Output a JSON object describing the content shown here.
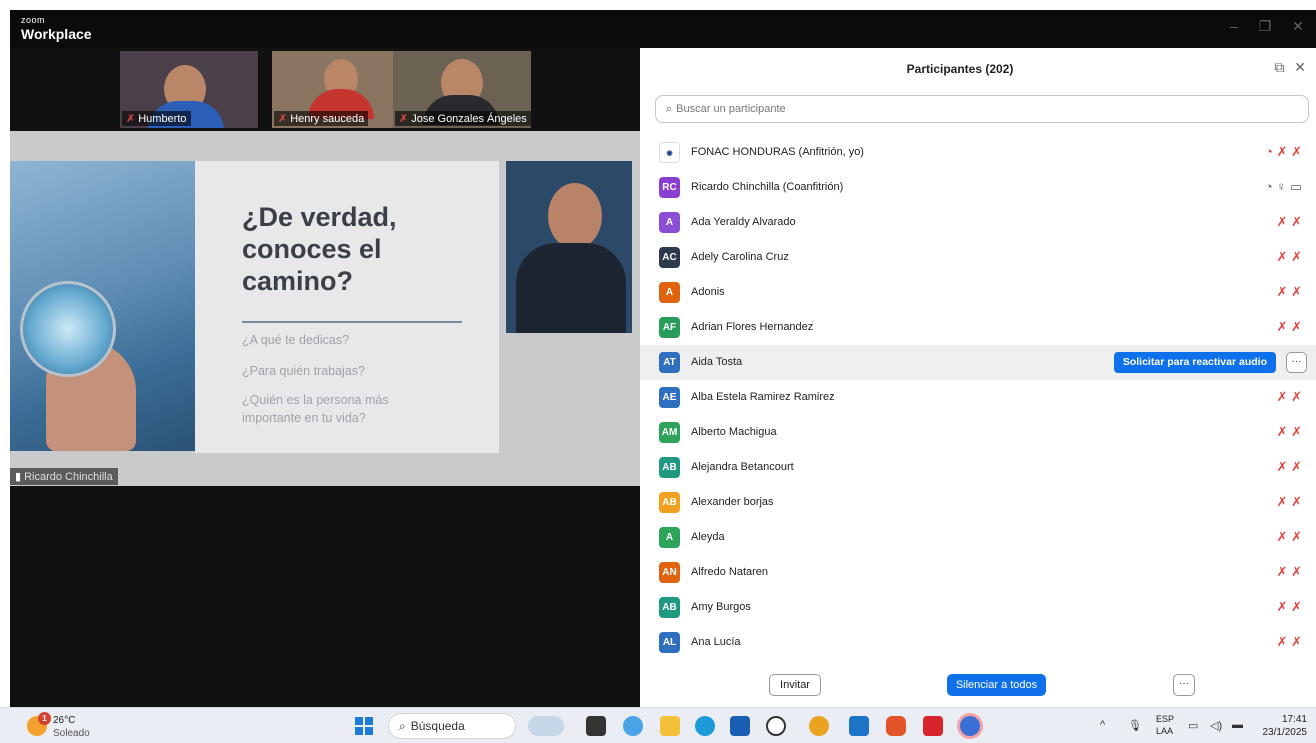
{
  "window": {
    "brand_small": "zoom",
    "brand_big": "Workplace"
  },
  "thumbnails": [
    {
      "name": "Humberto"
    },
    {
      "name": "Henry sauceda"
    },
    {
      "name": "Jose Gonzales Ángeles"
    }
  ],
  "share": {
    "title_lines": [
      "¿De verdad,",
      "conoces el",
      "camino?"
    ],
    "questions": [
      "¿A qué te dedicas?",
      "¿Para quién trabajas?",
      "¿Quién es la persona más",
      "importante en tu vida?"
    ],
    "presenter_label": "Ricardo Chinchilla"
  },
  "panel": {
    "title": "Participantes (202)",
    "search_placeholder": "Buscar un participante",
    "request_unmute": "Solicitar para reactivar audio",
    "more": "···",
    "participants": [
      {
        "initials": "",
        "name": "FONAC HONDURAS (Anfitrión, yo)",
        "color": "#ffffff"
      },
      {
        "initials": "RC",
        "name": "Ricardo Chinchilla (Coanfitrión)",
        "color": "#8a3fd1"
      },
      {
        "initials": "A",
        "name": "Ada Yeraldy Alvarado",
        "color": "#8a4fd6"
      },
      {
        "initials": "AC",
        "name": "Adely Carolina Cruz",
        "color": "#2d3a4d"
      },
      {
        "initials": "A",
        "name": "Adonis",
        "color": "#e0630f"
      },
      {
        "initials": "AF",
        "name": "Adrian Flores Hernandez",
        "color": "#2a9d5c"
      },
      {
        "initials": "AT",
        "name": "Aida Tosta",
        "color": "#2f6fbf"
      },
      {
        "initials": "AE",
        "name": "Alba Estela Ramirez Ramirez",
        "color": "#2f6fbf"
      },
      {
        "initials": "AM",
        "name": "Alberto Machigua",
        "color": "#2ea35a"
      },
      {
        "initials": "AB",
        "name": "Alejandra Betancourt",
        "color": "#1f9a80"
      },
      {
        "initials": "AB",
        "name": "Alexander borjas",
        "color": "#f0a01e"
      },
      {
        "initials": "A",
        "name": "Aleyda",
        "color": "#2ea35a"
      },
      {
        "initials": "AN",
        "name": "Alfredo Nataren",
        "color": "#e0630f"
      },
      {
        "initials": "AB",
        "name": "Amy Burgos",
        "color": "#1f9a80"
      },
      {
        "initials": "AL",
        "name": "Ana Lucía",
        "color": "#2f6fbf"
      }
    ],
    "invite": "Invitar",
    "mute_all": "Silenciar a todos",
    "footer_more": "···"
  },
  "taskbar": {
    "temperature": "26°C",
    "condition": "Soleado",
    "weather_badge": "1",
    "search": "Búsqueda",
    "lang_top": "ESP",
    "lang_bottom": "LAA",
    "time": "17:41",
    "date": "23/1/2025"
  }
}
